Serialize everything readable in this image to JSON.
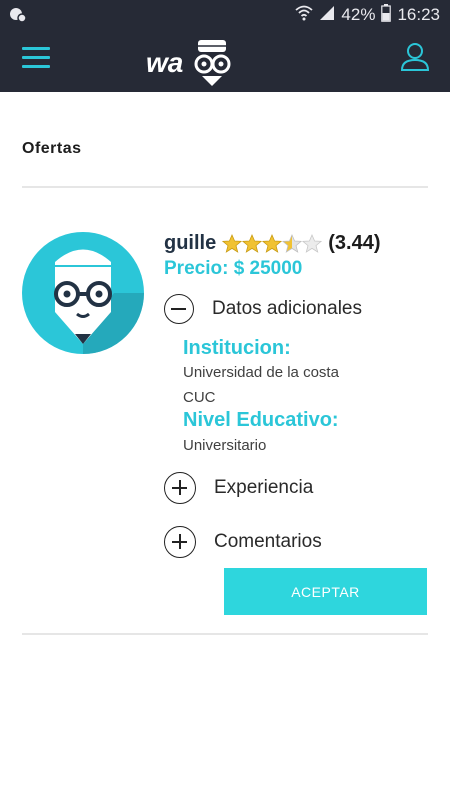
{
  "status_bar": {
    "battery_percent": "42%",
    "time": "16:23"
  },
  "app_bar": {
    "menu_icon": "hamburger-icon",
    "logo_text": "wa",
    "profile_icon": "user-icon"
  },
  "page": {
    "title": "Ofertas"
  },
  "offer": {
    "name": "guille",
    "rating_value": 3.44,
    "rating_text": "(3.44)",
    "price_text": "Precio: $ 25000",
    "sections": {
      "datos": {
        "label": "Datos adicionales",
        "expanded": true
      },
      "experiencia": {
        "label": "Experiencia",
        "expanded": false
      },
      "comentarios": {
        "label": "Comentarios",
        "expanded": false
      }
    },
    "details": {
      "institucion_label": "Institucion:",
      "institucion_line1": "Universidad de la costa",
      "institucion_line2": "CUC",
      "nivel_label": "Nivel Educativo:",
      "nivel_value": "Universitario"
    },
    "accept_label": "ACEPTAR"
  },
  "colors": {
    "bar": "#262a36",
    "accent": "#2bc6d8",
    "button": "#2ed6dd",
    "star": "#f1c232"
  }
}
